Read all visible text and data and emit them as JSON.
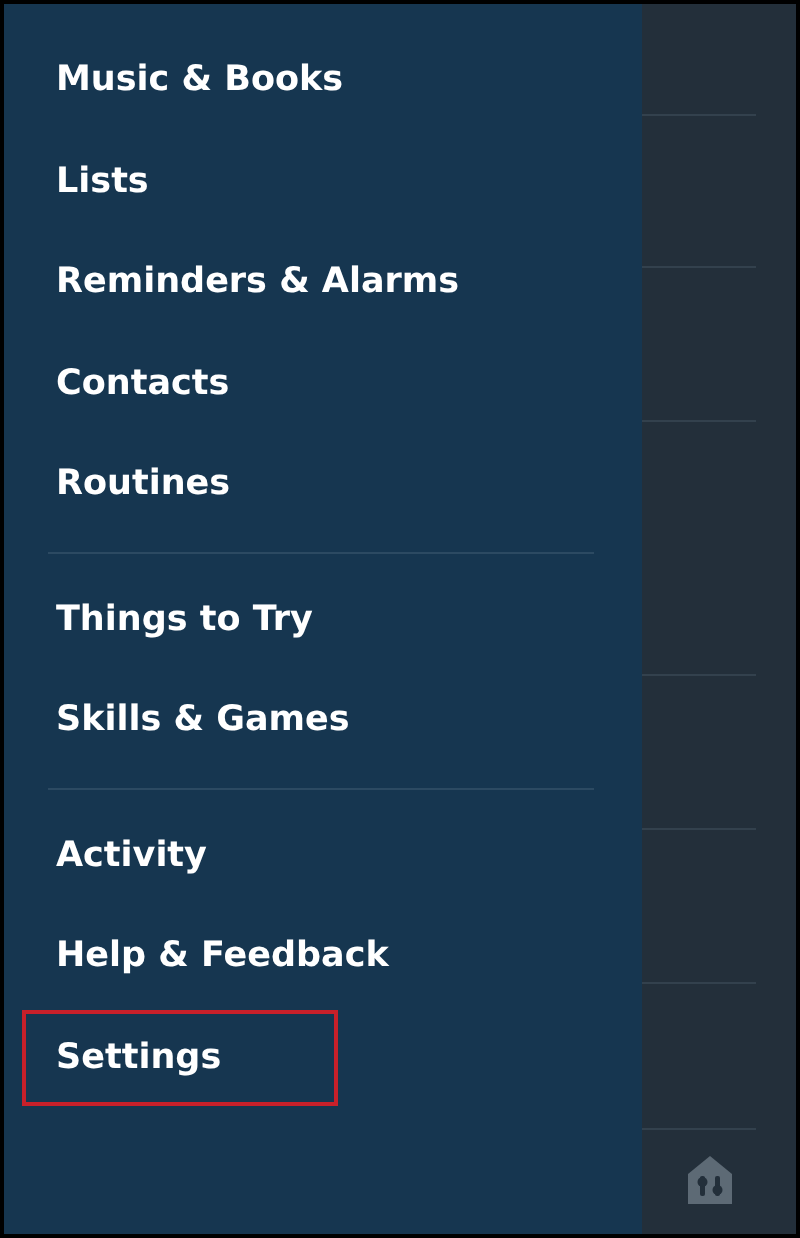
{
  "menu_sections": [
    {
      "items": [
        {
          "label": "Music & Books",
          "highlighted": false
        },
        {
          "label": "Lists",
          "highlighted": false
        },
        {
          "label": "Reminders & Alarms",
          "highlighted": false
        },
        {
          "label": "Contacts",
          "highlighted": false
        },
        {
          "label": "Routines",
          "highlighted": false
        }
      ]
    },
    {
      "items": [
        {
          "label": "Things to Try",
          "highlighted": false
        },
        {
          "label": "Skills & Games",
          "highlighted": false
        }
      ]
    },
    {
      "items": [
        {
          "label": "Activity",
          "highlighted": false
        },
        {
          "label": "Help & Feedback",
          "highlighted": false
        },
        {
          "label": "Settings",
          "highlighted": true
        }
      ]
    }
  ]
}
